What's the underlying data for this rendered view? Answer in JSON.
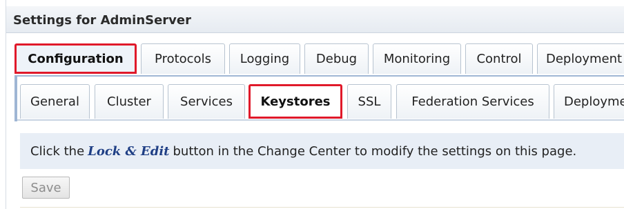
{
  "header": {
    "title": "Settings for AdminServer"
  },
  "main_tabs": [
    {
      "label": "Configuration",
      "active": true
    },
    {
      "label": "Protocols",
      "active": false
    },
    {
      "label": "Logging",
      "active": false
    },
    {
      "label": "Debug",
      "active": false
    },
    {
      "label": "Monitoring",
      "active": false
    },
    {
      "label": "Control",
      "active": false
    },
    {
      "label": "Deployment",
      "active": false
    }
  ],
  "sub_tabs": [
    {
      "label": "General",
      "active": false
    },
    {
      "label": "Cluster",
      "active": false
    },
    {
      "label": "Services",
      "active": false
    },
    {
      "label": "Keystores",
      "active": true
    },
    {
      "label": "SSL",
      "active": false
    },
    {
      "label": "Federation Services",
      "active": false
    },
    {
      "label": "Deployme",
      "active": false
    }
  ],
  "info_bar": {
    "text_before": "Click the",
    "emphasis": "Lock & Edit",
    "text_after": "button in the Change Center to modify the settings on this page."
  },
  "actions": {
    "save_label": "Save",
    "save_enabled": false
  },
  "colors": {
    "highlight_border": "#e0192a",
    "info_background": "#e8eef6",
    "emphasis_text": "#1f3f85"
  }
}
